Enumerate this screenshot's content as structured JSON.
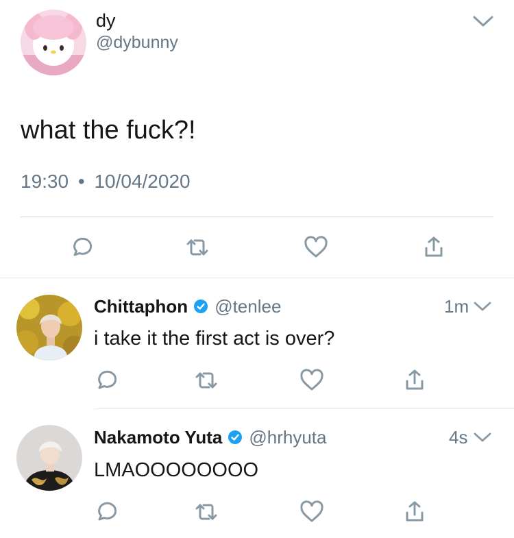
{
  "main_tweet": {
    "display_name": "dy",
    "handle": "@dybunny",
    "text": "what the fuck?!",
    "time": "19:30",
    "separator": "•",
    "date": "10/04/2020"
  },
  "replies": [
    {
      "display_name": "Chittaphon",
      "handle": "@tenlee",
      "time_ago": "1m",
      "text": "i take it the first act is over?",
      "verified": true
    },
    {
      "display_name": "Nakamoto Yuta",
      "handle": "@hrhyuta",
      "time_ago": "4s",
      "text": "LMAOOOOOOOO",
      "verified": true
    }
  ],
  "icons": {
    "reply": "reply-icon",
    "retweet": "retweet-icon",
    "like": "heart-icon",
    "share": "share-icon",
    "more": "chevron-down-icon",
    "verified": "verified-badge-icon"
  },
  "colors": {
    "text": "#14171a",
    "muted": "#657786",
    "icon": "#8899a6",
    "verified": "#1da1f2",
    "divider": "#cfd6db"
  }
}
